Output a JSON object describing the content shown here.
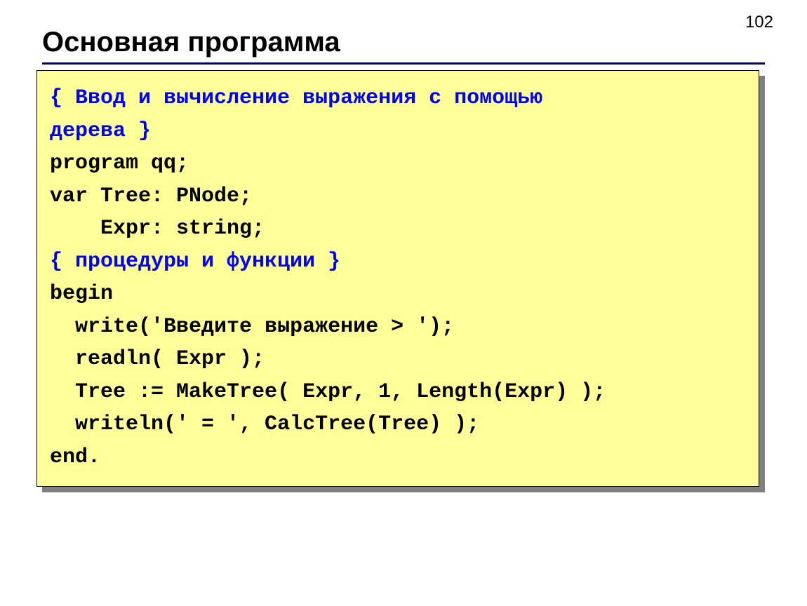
{
  "page_number": "102",
  "title": "Основная программа",
  "code": {
    "comment1_a": "{ Ввод и вычисление выражения с помощью",
    "comment1_b": "дерева }",
    "l1": "program qq;",
    "l2": "var Tree: PNode;",
    "l3": "    Expr: string;",
    "comment2": "{ процедуры и функции }",
    "l4": "begin",
    "l5": "  write('Введите выражение > ');",
    "l6": "  readln( Expr );",
    "l7": "  Tree := MakeTree( Expr, 1, Length(Expr) );",
    "l8": "  writeln(' = ', CalcTree(Tree) );",
    "l9": "end."
  }
}
